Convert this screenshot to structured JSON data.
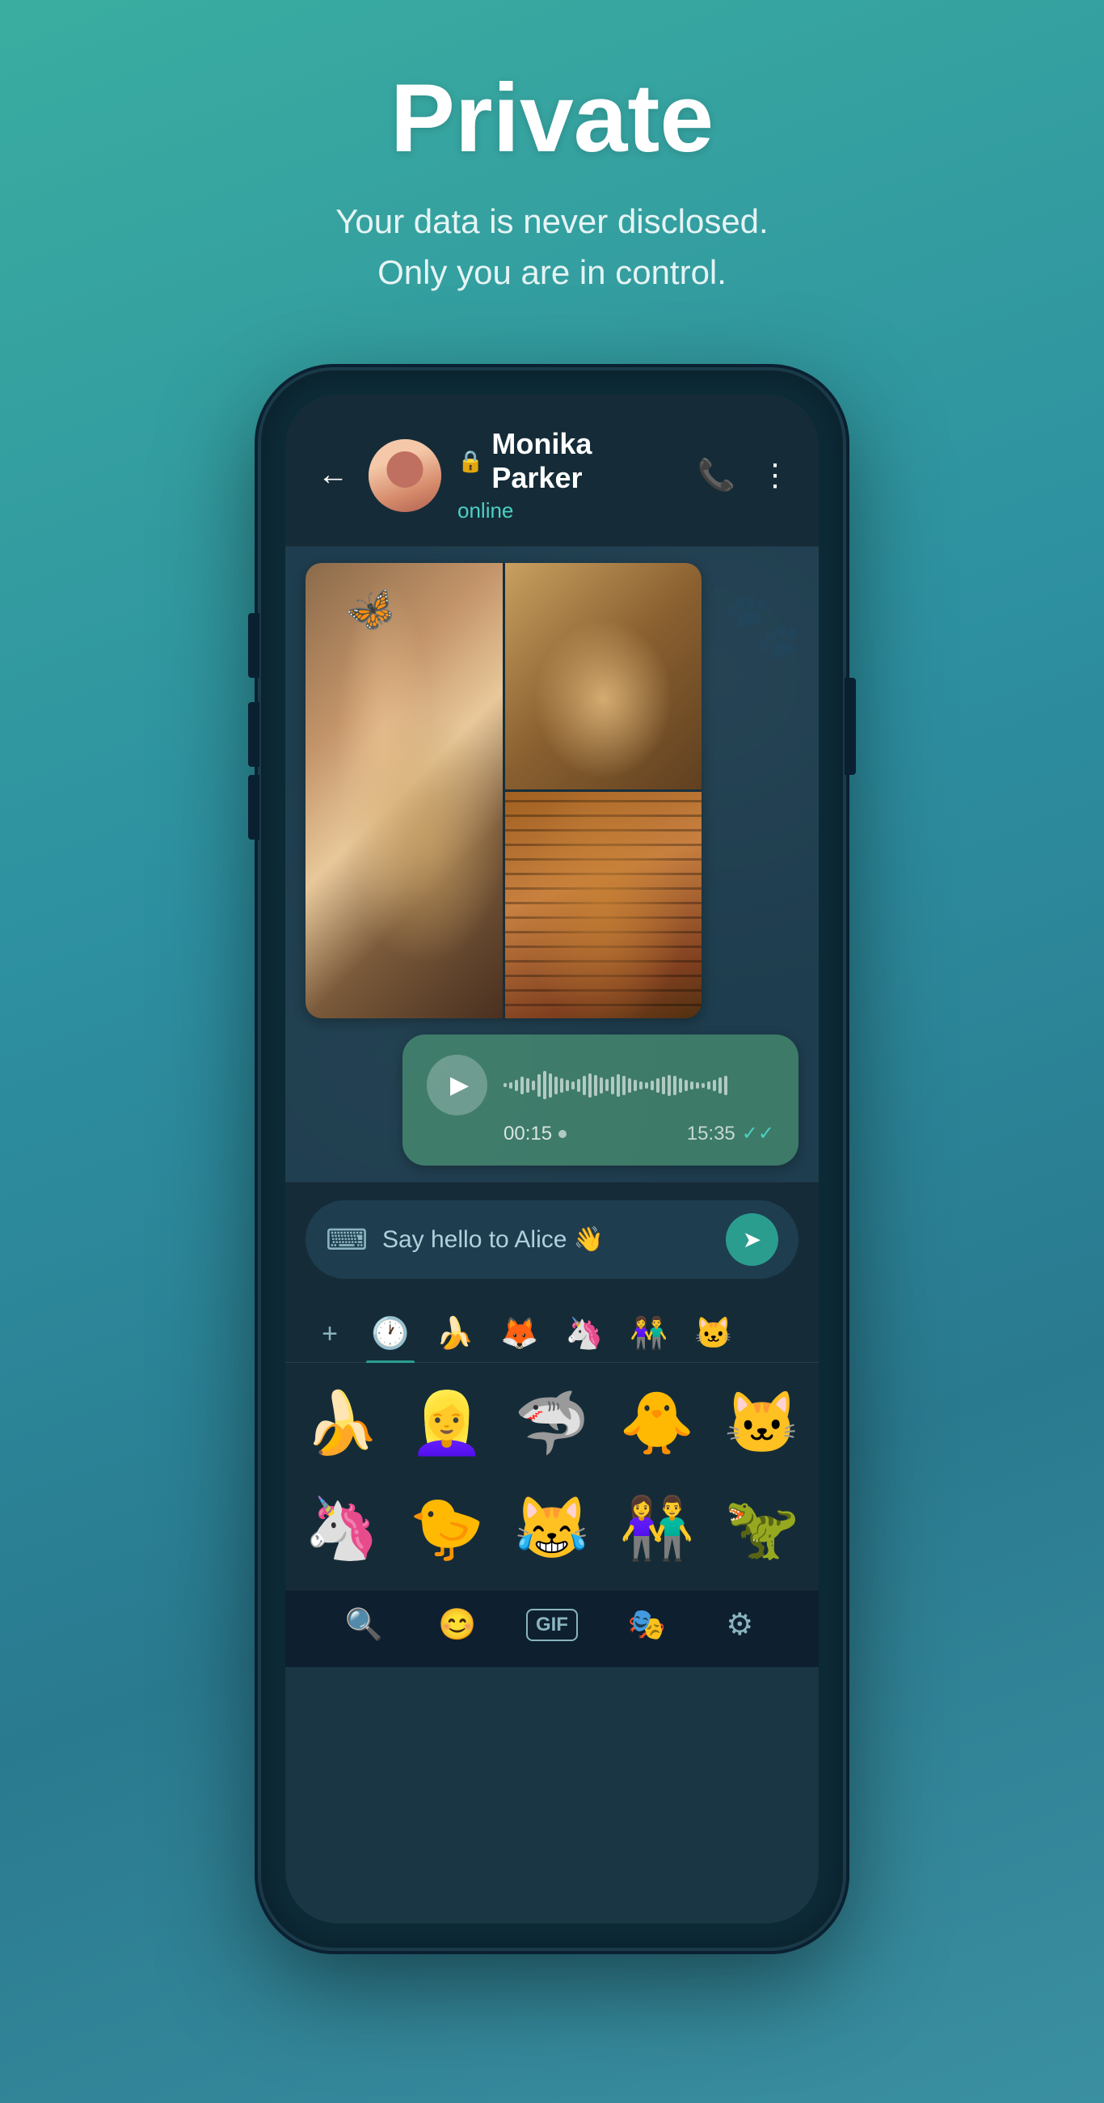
{
  "hero": {
    "title": "Private",
    "subtitle_line1": "Your data is never disclosed.",
    "subtitle_line2": "Only you are in control."
  },
  "chat_header": {
    "back_label": "←",
    "contact_name": "Monika Parker",
    "contact_status": "online",
    "lock_symbol": "🔒",
    "phone_icon": "📞",
    "menu_icon": "⋮"
  },
  "voice_message": {
    "duration": "00:15",
    "dot": "●",
    "timestamp": "15:35",
    "check_mark": "✓✓"
  },
  "input": {
    "text": "Say hello to Alice 👋",
    "keyboard_icon": "⌨",
    "send_icon": "➤"
  },
  "sticker_tabs": [
    {
      "id": "add",
      "icon": "+"
    },
    {
      "id": "recent",
      "icon": "🕐",
      "active": true
    },
    {
      "id": "banana",
      "icon": "🍌"
    },
    {
      "id": "fox",
      "icon": "🦊"
    },
    {
      "id": "unicorn",
      "icon": "🦄"
    },
    {
      "id": "couple",
      "icon": "👫"
    },
    {
      "id": "cat2",
      "icon": "🐱"
    }
  ],
  "stickers_row1": [
    {
      "id": "banana-beach",
      "emoji": "🍌🏖️"
    },
    {
      "id": "marilyn",
      "emoji": "💋👱‍♀️"
    },
    {
      "id": "shark",
      "emoji": "🦈"
    },
    {
      "id": "duck-hearts",
      "emoji": "🐥❤️"
    },
    {
      "id": "cat-roar",
      "emoji": "🐱😾"
    }
  ],
  "stickers_row2": [
    {
      "id": "unicorn2",
      "emoji": "🦄"
    },
    {
      "id": "duck-cry",
      "emoji": "🐤😢"
    },
    {
      "id": "haha",
      "emoji": "😹"
    },
    {
      "id": "couple2",
      "emoji": "👫💃"
    },
    {
      "id": "dino",
      "emoji": "🦖"
    }
  ],
  "bottom_bar": {
    "search_icon": "🔍",
    "emoji_icon": "😊",
    "gif_label": "GIF",
    "sticker_icon": "🎭",
    "settings_icon": "⚙"
  },
  "wave_bars": [
    5,
    8,
    14,
    22,
    18,
    12,
    28,
    35,
    30,
    22,
    18,
    14,
    10,
    16,
    24,
    30,
    26,
    20,
    15,
    22,
    28,
    24,
    18,
    14,
    10,
    8,
    12,
    18,
    22,
    26,
    24,
    18,
    14,
    10,
    8,
    6,
    10,
    14,
    20,
    24
  ]
}
